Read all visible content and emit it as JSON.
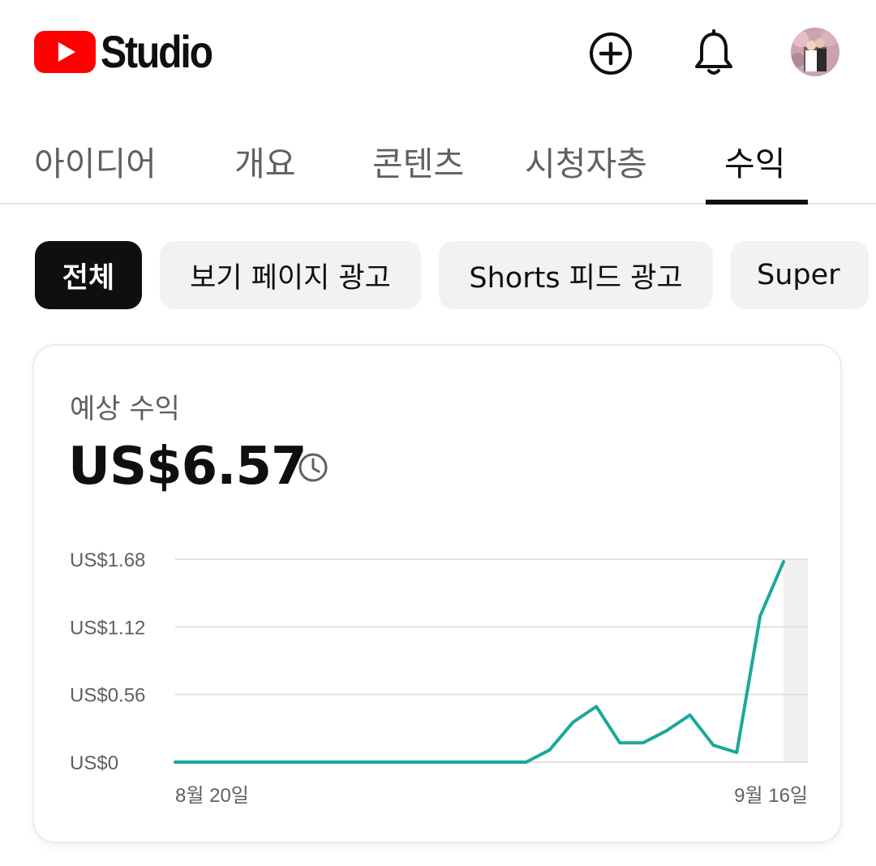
{
  "header": {
    "logo_text": "Studio",
    "create_icon": "add-circle-icon",
    "notifications_icon": "bell-icon",
    "avatar": "account-avatar"
  },
  "tabs": [
    {
      "label": "아이디어",
      "active": false
    },
    {
      "label": "개요",
      "active": false
    },
    {
      "label": "콘텐츠",
      "active": false
    },
    {
      "label": "시청자층",
      "active": false
    },
    {
      "label": "수익",
      "active": true
    }
  ],
  "chips": [
    {
      "label": "전체",
      "active": true
    },
    {
      "label": "보기 페이지 광고",
      "active": false
    },
    {
      "label": "Shorts 피드 광고",
      "active": false
    },
    {
      "label": "Super",
      "active": false
    }
  ],
  "revenue_card": {
    "title": "예상 수익",
    "value": "US$6.57",
    "info_icon": "clock-icon"
  },
  "colors": {
    "brand_red": "#ff0000",
    "line": "#1aa99a",
    "active_chip": "#0f0f0f"
  },
  "chart_data": {
    "type": "line",
    "ylim": [
      0,
      1.68
    ],
    "y_ticks": [
      {
        "value": 0,
        "label": "US$0"
      },
      {
        "value": 0.56,
        "label": "US$0.56"
      },
      {
        "value": 1.12,
        "label": "US$1.12"
      },
      {
        "value": 1.68,
        "label": "US$1.68"
      }
    ],
    "x_start_label": "8월 20일",
    "x_end_label": "9월 16일",
    "grid": true,
    "highlight_last_day": true,
    "series": [
      {
        "values": [
          0,
          0,
          0,
          0,
          0,
          0,
          0,
          0,
          0,
          0,
          0,
          0,
          0,
          0,
          0,
          0,
          0.1,
          0.33,
          0.46,
          0.16,
          0.16,
          0.26,
          0.39,
          0.14,
          0.08,
          1.21,
          1.66
        ]
      }
    ]
  }
}
